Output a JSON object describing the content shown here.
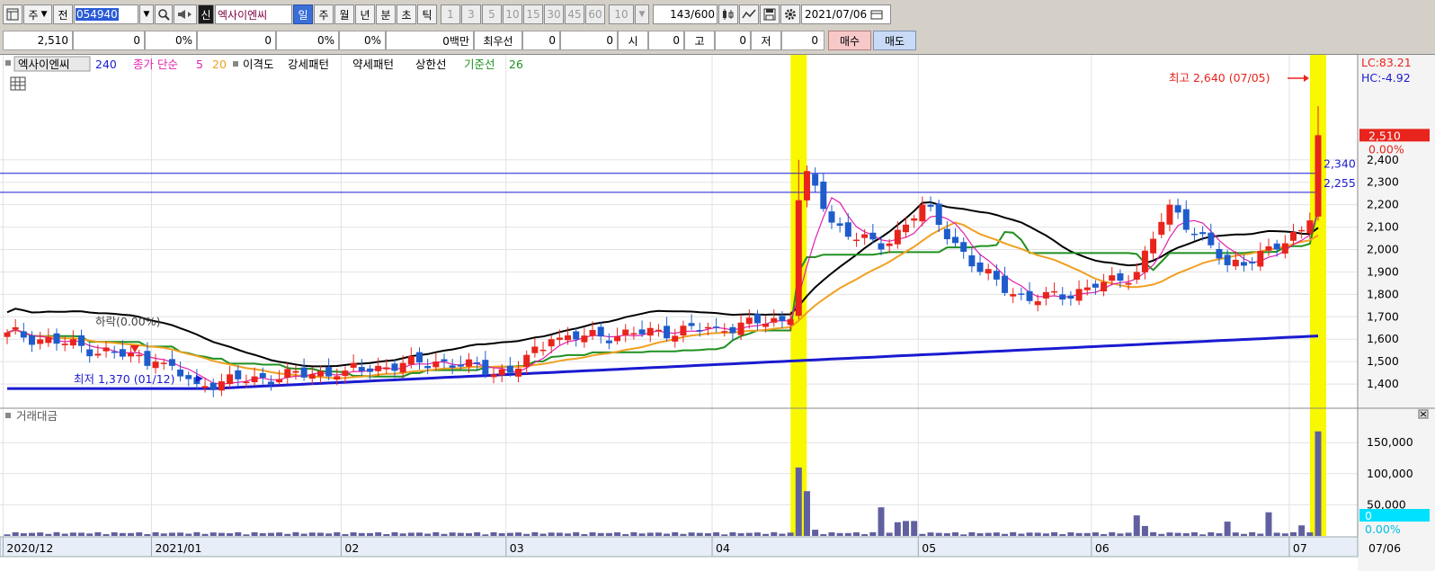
{
  "toolbar": {
    "market_label": "주",
    "full_label": "전",
    "stock_code": "054940",
    "badge_new": "신",
    "stock_name": "엑사이엔씨",
    "periods": [
      "일",
      "주",
      "월",
      "년",
      "분",
      "초",
      "틱"
    ],
    "active_period": "일",
    "minute_steps": [
      "1",
      "3",
      "5",
      "10",
      "15",
      "30",
      "45",
      "60"
    ],
    "custom_step": "10",
    "count_display": "143",
    "count_max": "/600",
    "date": "2021/07/06"
  },
  "quote": {
    "price": "2,510",
    "change": "0",
    "change_pct": "0%",
    "volume": "0",
    "volume_pct": "0%",
    "turnover_pct": "0%",
    "amount": "0백만",
    "best_bid_label": "최우선",
    "bid": "0",
    "ask": "0",
    "open_label": "시",
    "open": "0",
    "high_label": "고",
    "high": "0",
    "low_label": "저",
    "low": "0",
    "buy_label": "매수",
    "sell_label": "매도"
  },
  "colors": {
    "up": "#e8241c",
    "down": "#1e5ccc",
    "ma5": "#e020b0",
    "ma20": "#f0a020",
    "ma240": "#1a1ad0",
    "envelope": "#000000",
    "base_line": "#209020",
    "highlight": "#f8f800",
    "volume_bar": "#6060a0"
  },
  "chart_data": [
    {
      "type": "candlestick",
      "title": "엑사이엔씨",
      "legend": {
        "stock": "엑사이엔씨",
        "ma240": "240",
        "close_label": "종가 단순",
        "ma5": "5",
        "ma20": "20",
        "disparity": "이격도",
        "strong_pattern": "강세패턴",
        "weak_pattern": "약세패턴",
        "upper_limit": "상한선",
        "base_line": "기준선",
        "base_period": "26"
      },
      "y_range": [
        1300,
        2720
      ],
      "y_ticks": [
        "2,400",
        "2,300",
        "2,200",
        "2,100",
        "2,000",
        "1,900",
        "1,800",
        "1,700",
        "1,600",
        "1,500",
        "1,400"
      ],
      "y_tick_values": [
        2400,
        2300,
        2200,
        2100,
        2000,
        1900,
        1800,
        1700,
        1600,
        1500,
        1400
      ],
      "x_labels": [
        "2020/12",
        "2021/01",
        "02",
        "03",
        "04",
        "05",
        "06",
        "07"
      ],
      "x_label_index": [
        0,
        18,
        41,
        61,
        86,
        111,
        132,
        156
      ],
      "end_date_label": "07/06",
      "num_bars": 160,
      "horizontal_lines": [
        2340,
        2255
      ],
      "horizontal_line_labels": [
        "2,340",
        "2,255"
      ],
      "highlight_bars": [
        96,
        159
      ],
      "price_badge": "2,510",
      "price_badge_pct": "0.00%",
      "lc": "LC:83.21",
      "hc": "HC:-4.92",
      "annotation_high": "최고 2,640 (07/05)",
      "annotation_low": "최저 1,370 (01/12)",
      "annotation_drop": "하락(0.00%)",
      "key_points": [
        {
          "index": 0,
          "close": 1630
        },
        {
          "index": 18,
          "close": 1500
        },
        {
          "index": 23,
          "close": 1400
        },
        {
          "index": 41,
          "close": 1460
        },
        {
          "index": 52,
          "close": 1500
        },
        {
          "index": 61,
          "close": 1450
        },
        {
          "index": 66,
          "close": 1600
        },
        {
          "index": 86,
          "close": 1650
        },
        {
          "index": 95,
          "close": 1690
        },
        {
          "index": 96,
          "close": 2220,
          "high": 2400
        },
        {
          "index": 97,
          "close": 2350
        },
        {
          "index": 100,
          "close": 2120
        },
        {
          "index": 106,
          "close": 2000
        },
        {
          "index": 111,
          "close": 2200
        },
        {
          "index": 118,
          "close": 1900
        },
        {
          "index": 124,
          "close": 1770
        },
        {
          "index": 132,
          "close": 1830
        },
        {
          "index": 137,
          "close": 1900
        },
        {
          "index": 141,
          "close": 2200
        },
        {
          "index": 148,
          "close": 1930
        },
        {
          "index": 154,
          "close": 2000
        },
        {
          "index": 158,
          "close": 2130
        },
        {
          "index": 159,
          "close": 2510,
          "high": 2640
        }
      ]
    },
    {
      "type": "bar",
      "title": "거래대금",
      "y_ticks": [
        "150,000",
        "100,000",
        "50,000"
      ],
      "y_tick_values": [
        150000,
        100000,
        50000
      ],
      "y_max": 185000,
      "current_value": "0",
      "current_pct": "0.00%",
      "spikes": [
        {
          "index": 96,
          "value": 110000
        },
        {
          "index": 97,
          "value": 72000
        },
        {
          "index": 98,
          "value": 10000
        },
        {
          "index": 106,
          "value": 46000
        },
        {
          "index": 108,
          "value": 22000
        },
        {
          "index": 109,
          "value": 24000
        },
        {
          "index": 110,
          "value": 24000
        },
        {
          "index": 137,
          "value": 33000
        },
        {
          "index": 138,
          "value": 16000
        },
        {
          "index": 148,
          "value": 23000
        },
        {
          "index": 153,
          "value": 38000
        },
        {
          "index": 157,
          "value": 17000
        },
        {
          "index": 159,
          "value": 168000
        }
      ]
    }
  ]
}
